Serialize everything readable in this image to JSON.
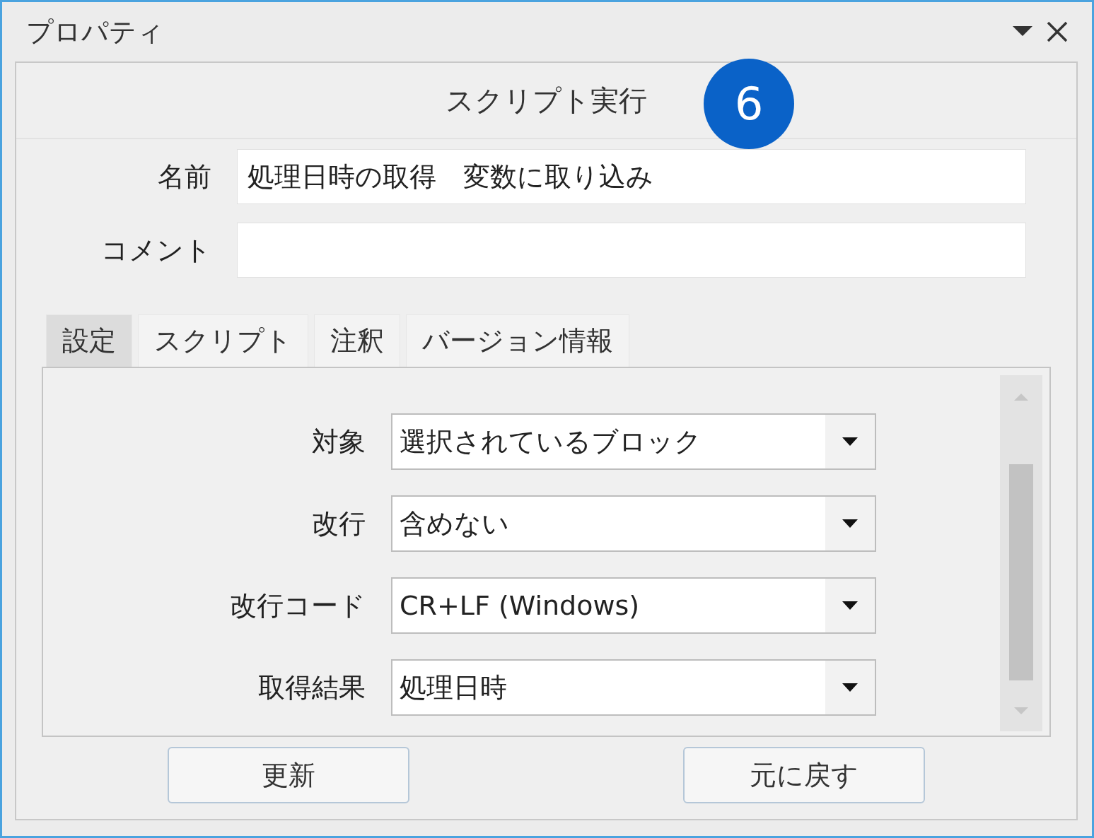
{
  "window": {
    "title": "プロパティ"
  },
  "panel": {
    "header": "スクリプト実行",
    "badge": "6"
  },
  "fields": [
    {
      "label": "名前",
      "value": "処理日時の取得　変数に取り込み"
    },
    {
      "label": "コメント"
    }
  ],
  "tabs": [
    {
      "label": "設定",
      "selected": true
    },
    {
      "label": "スクリプト",
      "selected": false
    },
    {
      "label": "注釈",
      "selected": false
    },
    {
      "label": "バージョン情報",
      "selected": false
    }
  ],
  "settings": [
    {
      "label": "対象",
      "value": "選択されているブロック"
    },
    {
      "label": "改行",
      "value": "含めない"
    },
    {
      "label": "改行コード",
      "value": "CR+LF (Windows)"
    },
    {
      "label": "取得結果",
      "value": "処理日時"
    }
  ],
  "buttons": [
    "更新",
    "元に戻す"
  ]
}
